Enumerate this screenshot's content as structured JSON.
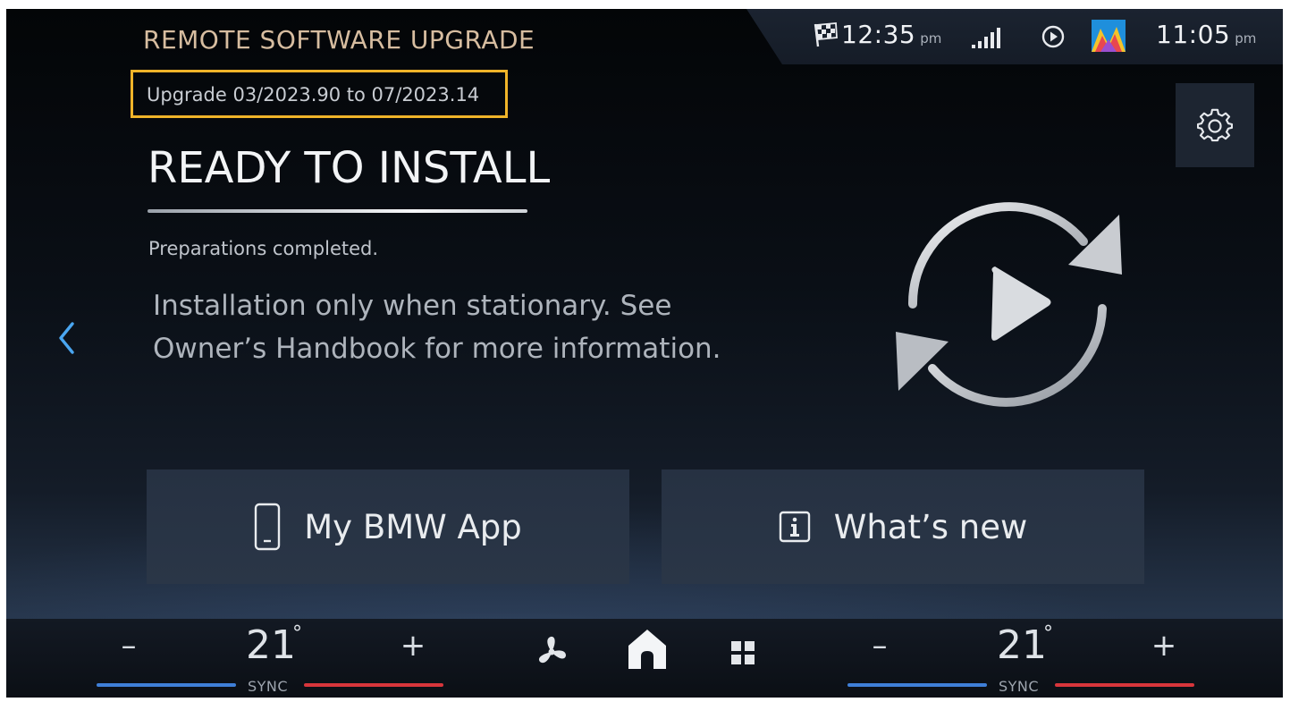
{
  "header": {
    "title": "REMOTE SOFTWARE UPGRADE",
    "version_text": "Upgrade 03/2023.90 to 07/2023.14"
  },
  "status_bar": {
    "flag_icon": "checkered-flag-icon",
    "arrival_time": "12:35",
    "arrival_ampm": "pm",
    "signal_icon": "signal-strength-icon",
    "media_icon": "media-play-icon",
    "app_icon": "colorful-mountains-icon",
    "clock_time": "11:05",
    "clock_ampm": "pm"
  },
  "main": {
    "status_heading": "READY TO INSTALL",
    "subtitle": "Preparations completed.",
    "info_text": "Installation only when stationary. See Owner’s Handbook for more information.",
    "graphic_icon": "install-refresh-play-icon"
  },
  "buttons": {
    "app_label": "My BMW App",
    "app_icon": "phone-icon",
    "whatsnew_label": "What’s new",
    "whatsnew_icon": "info-icon"
  },
  "bottom_bar": {
    "left_temp": "21",
    "left_degree": "°",
    "left_sync": "SYNC",
    "right_temp": "21",
    "right_degree": "°",
    "right_sync": "SYNC",
    "minus_symbol": "–",
    "plus_symbol": "+"
  },
  "colors": {
    "highlight_box": "#f0b429",
    "accent_blue": "#3f7fd8",
    "accent_red": "#d8353b",
    "title_color": "#d7bda0"
  }
}
